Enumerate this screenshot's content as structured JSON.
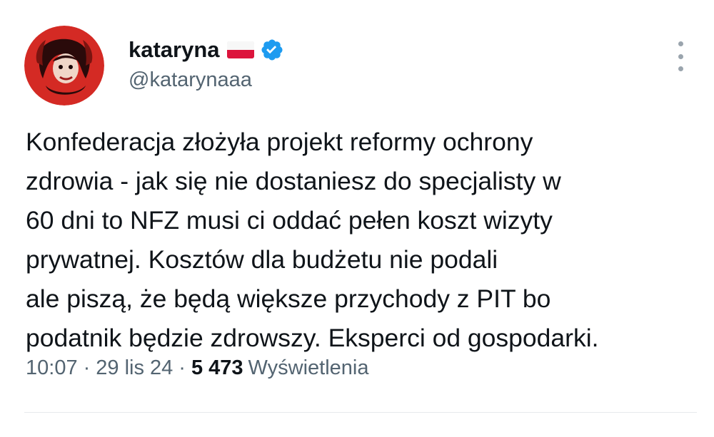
{
  "author": {
    "display_name": "kataryna",
    "handle": "@katarynaaa",
    "flag_icon": "poland-flag-icon",
    "verified_icon": "verified-badge-icon",
    "verified_color": "#1d9bf0",
    "avatar_icon": "red-circular-avatar"
  },
  "menu": {
    "more_icon": "more-vertical-icon"
  },
  "tweet": {
    "lines": [
      "Konfederacja złożyła projekt reformy ochrony",
      "zdrowia - jak się nie dostaniesz do specjalisty w",
      "60 dni to NFZ musi ci oddać pełen koszt wizyty",
      "prywatnej. Kosztów dla budżetu nie podali",
      "ale piszą, że będą większe przychody z PIT bo",
      "podatnik będzie zdrowszy. Eksperci od gospodarki."
    ]
  },
  "meta": {
    "time": "10:07",
    "separator": "·",
    "date": "29 lis 24",
    "views_count": "5 473",
    "views_label": "Wyświetlenia"
  },
  "colors": {
    "text": "#0f1419",
    "secondary": "#536471",
    "accent": "#1d9bf0",
    "divider": "#e6eaed"
  }
}
